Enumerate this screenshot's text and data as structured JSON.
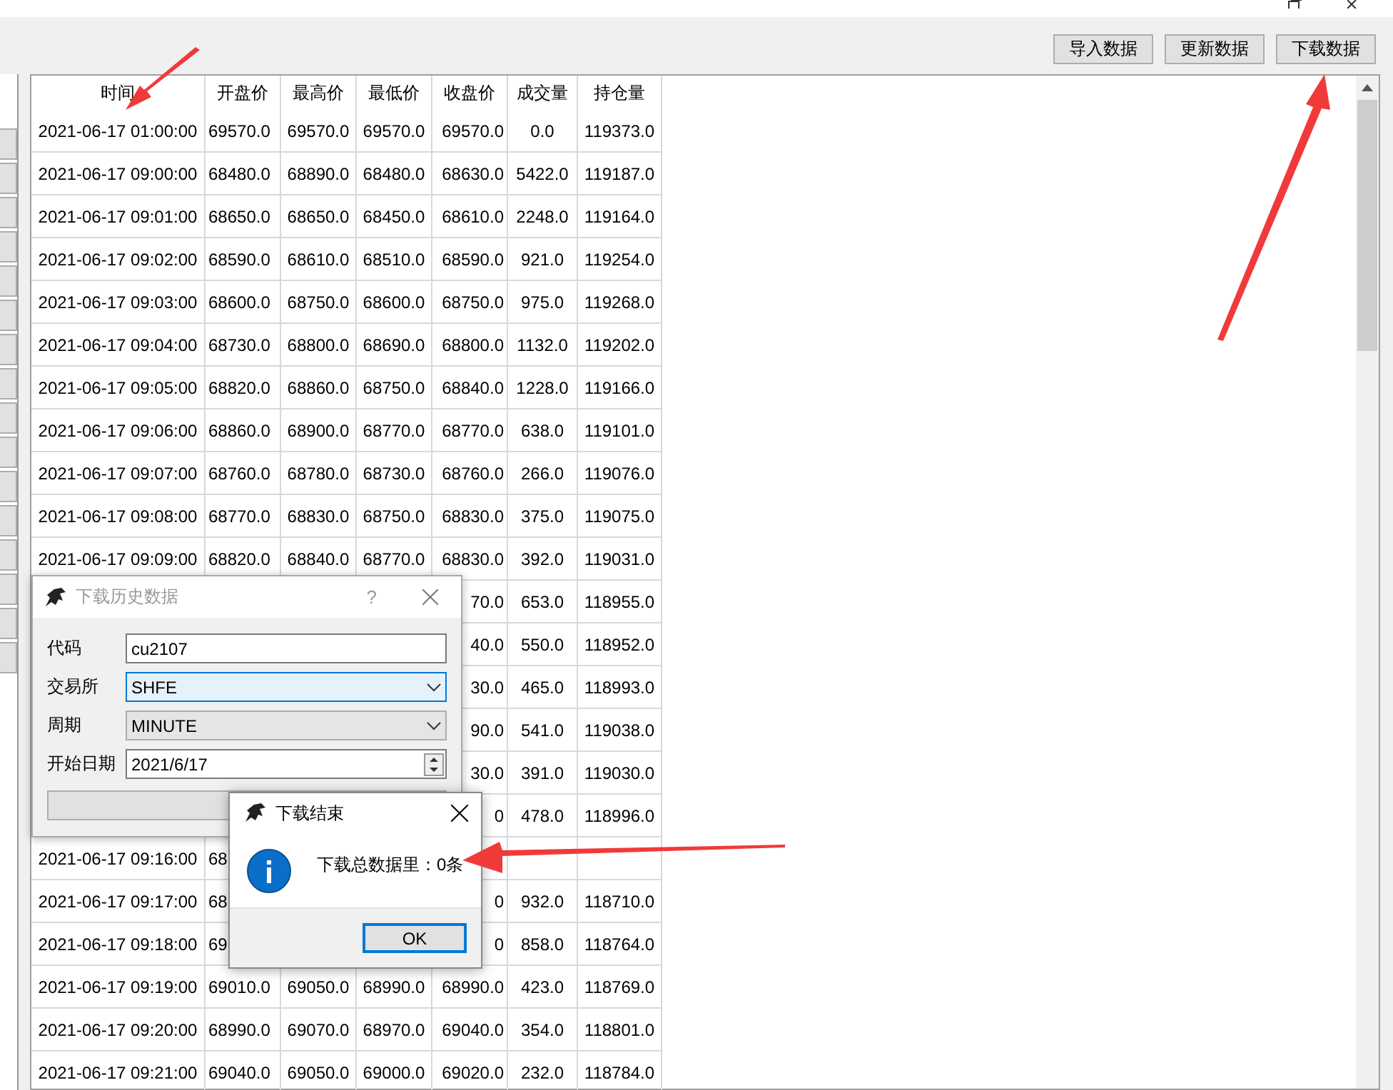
{
  "toolbar": {
    "buttons": [
      "导入数据",
      "更新数据",
      "下载数据"
    ]
  },
  "table": {
    "columns": [
      "时间",
      "开盘价",
      "最高价",
      "最低价",
      "收盘价",
      "成交量",
      "持仓量"
    ],
    "rows": [
      [
        "2021-06-17 01:00:00",
        "69570.0",
        "69570.0",
        "69570.0",
        "69570.0",
        "0.0",
        "119373.0"
      ],
      [
        "2021-06-17 09:00:00",
        "68480.0",
        "68890.0",
        "68480.0",
        "68630.0",
        "5422.0",
        "119187.0"
      ],
      [
        "2021-06-17 09:01:00",
        "68650.0",
        "68650.0",
        "68450.0",
        "68610.0",
        "2248.0",
        "119164.0"
      ],
      [
        "2021-06-17 09:02:00",
        "68590.0",
        "68610.0",
        "68510.0",
        "68590.0",
        "921.0",
        "119254.0"
      ],
      [
        "2021-06-17 09:03:00",
        "68600.0",
        "68750.0",
        "68600.0",
        "68750.0",
        "975.0",
        "119268.0"
      ],
      [
        "2021-06-17 09:04:00",
        "68730.0",
        "68800.0",
        "68690.0",
        "68800.0",
        "1132.0",
        "119202.0"
      ],
      [
        "2021-06-17 09:05:00",
        "68820.0",
        "68860.0",
        "68750.0",
        "68840.0",
        "1228.0",
        "119166.0"
      ],
      [
        "2021-06-17 09:06:00",
        "68860.0",
        "68900.0",
        "68770.0",
        "68770.0",
        "638.0",
        "119101.0"
      ],
      [
        "2021-06-17 09:07:00",
        "68760.0",
        "68780.0",
        "68730.0",
        "68760.0",
        "266.0",
        "119076.0"
      ],
      [
        "2021-06-17 09:08:00",
        "68770.0",
        "68830.0",
        "68750.0",
        "68830.0",
        "375.0",
        "119075.0"
      ],
      [
        "2021-06-17 09:09:00",
        "68820.0",
        "68840.0",
        "68770.0",
        "68830.0",
        "392.0",
        "119031.0"
      ],
      [
        null,
        null,
        null,
        null,
        "70.0",
        "653.0",
        "118955.0"
      ],
      [
        null,
        null,
        null,
        null,
        "40.0",
        "550.0",
        "118952.0"
      ],
      [
        null,
        null,
        null,
        null,
        "30.0",
        "465.0",
        "118993.0"
      ],
      [
        null,
        null,
        null,
        null,
        "90.0",
        "541.0",
        "119038.0"
      ],
      [
        null,
        null,
        null,
        null,
        "30.0",
        "391.0",
        "119030.0"
      ],
      [
        null,
        null,
        null,
        null,
        "0",
        "478.0",
        "118996.0"
      ],
      [
        "2021-06-17 09:16:00",
        "68",
        null,
        null,
        null,
        null,
        null
      ],
      [
        "2021-06-17 09:17:00",
        "68",
        null,
        null,
        "0",
        "932.0",
        "118710.0"
      ],
      [
        "2021-06-17 09:18:00",
        "69",
        null,
        null,
        "0",
        "858.0",
        "118764.0"
      ],
      [
        "2021-06-17 09:19:00",
        "69010.0",
        "69050.0",
        "68990.0",
        "68990.0",
        "423.0",
        "118769.0"
      ],
      [
        "2021-06-17 09:20:00",
        "68990.0",
        "69070.0",
        "68970.0",
        "69040.0",
        "354.0",
        "118801.0"
      ],
      [
        "2021-06-17 09:21:00",
        "69040.0",
        "69050.0",
        "69000.0",
        "69020.0",
        "232.0",
        "118784.0"
      ]
    ]
  },
  "history_dialog": {
    "title": "下载历史数据",
    "active": false,
    "help": "?",
    "fields": [
      {
        "label": "代码",
        "kind": "text",
        "value": "cu2107"
      },
      {
        "label": "交易所",
        "kind": "combo",
        "value": "SHFE",
        "focused": true
      },
      {
        "label": "周期",
        "kind": "combo",
        "value": "MINUTE",
        "focused": false
      },
      {
        "label": "开始日期",
        "kind": "spin",
        "value": "2021/6/17"
      }
    ]
  },
  "result_dialog": {
    "title": "下载结束",
    "message": "下载总数据里：0条",
    "button": "OK"
  }
}
